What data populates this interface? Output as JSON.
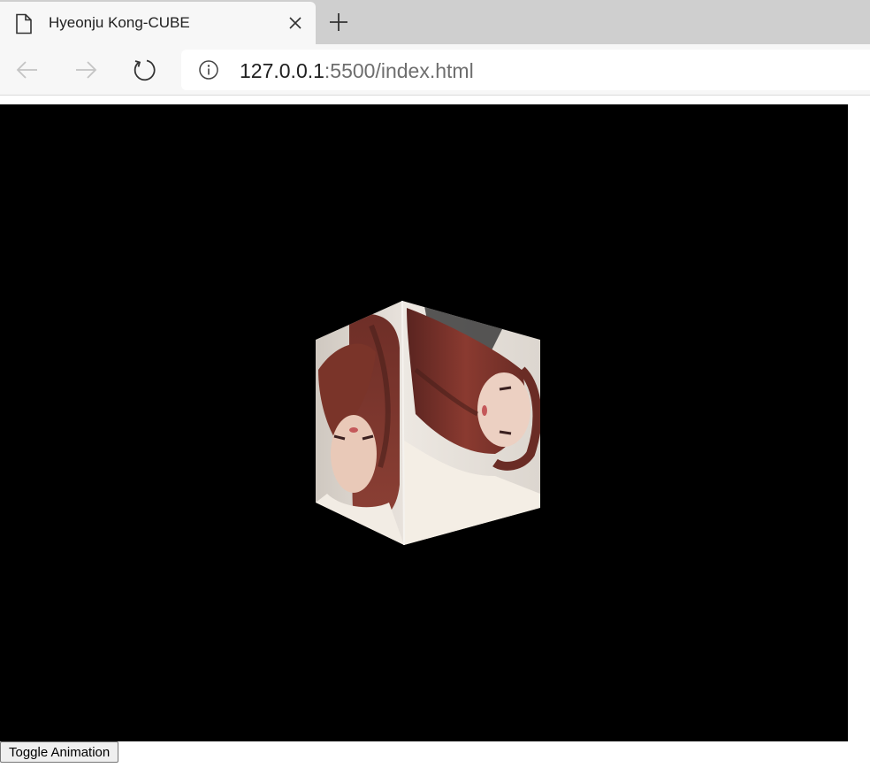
{
  "browser": {
    "tab_title": "Hyeonju Kong-CUBE",
    "url_host": "127.0.0.1",
    "url_rest": ":5500/index.html",
    "icons": {
      "tab": "page-icon",
      "close": "close-icon",
      "new_tab": "plus-icon",
      "back": "arrow-left-icon",
      "forward": "arrow-right-icon",
      "reload": "reload-icon",
      "site_info": "info-icon"
    }
  },
  "page": {
    "toggle_label": "Toggle Animation",
    "stage_color": "#000000"
  }
}
